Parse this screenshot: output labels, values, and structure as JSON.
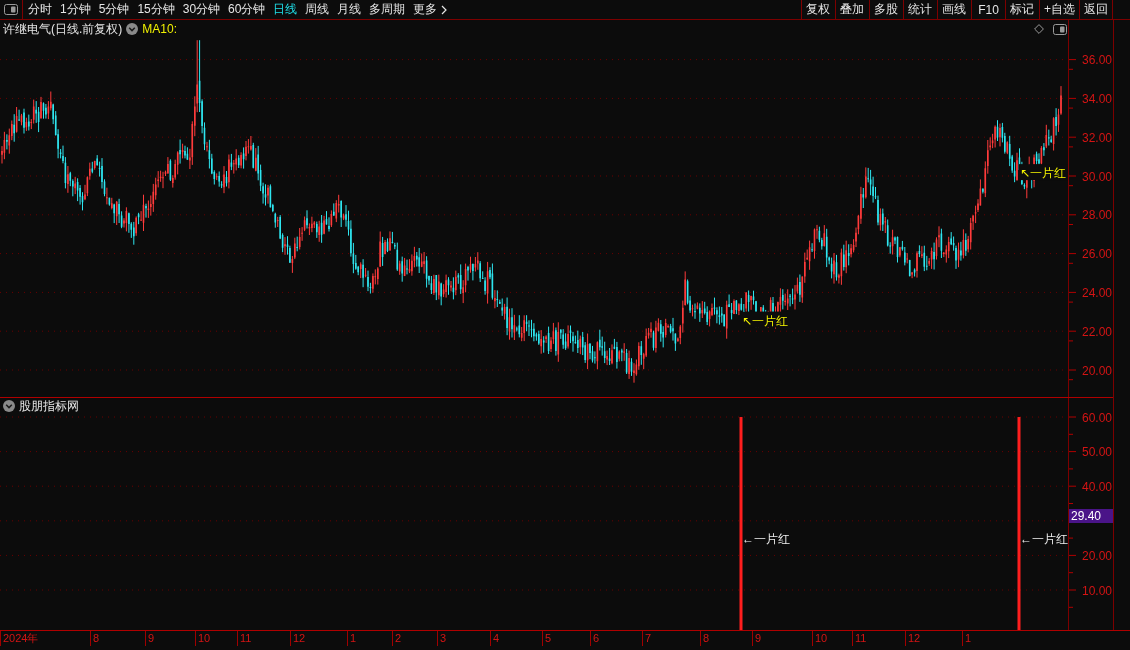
{
  "toolbar": {
    "periods": [
      {
        "label": "分时",
        "selected": false
      },
      {
        "label": "1分钟",
        "selected": false
      },
      {
        "label": "5分钟",
        "selected": false
      },
      {
        "label": "15分钟",
        "selected": false
      },
      {
        "label": "30分钟",
        "selected": false
      },
      {
        "label": "60分钟",
        "selected": false
      },
      {
        "label": "日线",
        "selected": true
      },
      {
        "label": "周线",
        "selected": false
      },
      {
        "label": "月线",
        "selected": false
      },
      {
        "label": "多周期",
        "selected": false
      }
    ],
    "more": "更多",
    "actions": [
      "复权",
      "叠加",
      "多股",
      "统计",
      "画线",
      "F10",
      "标记",
      "+自选",
      "返回"
    ]
  },
  "price_chart": {
    "title": "许继电气(日线.前复权)",
    "indicator": "MA10:",
    "price_axis": [
      "36.00",
      "34.00",
      "32.00",
      "30.00",
      "28.00",
      "26.00",
      "24.00",
      "22.00",
      "20.00"
    ],
    "annotations": [
      "↖一片红",
      "↖一片红"
    ]
  },
  "indicator_panel": {
    "title": "股朋指标网",
    "value_axis": [
      "60.00",
      "50.00",
      "40.00",
      "20.00",
      "10.00"
    ],
    "current_value": "29.40",
    "signals": [
      "←一片红",
      "←一片红"
    ]
  },
  "time_axis": [
    "2024年",
    "8",
    "9",
    "10",
    "11",
    "12",
    "1",
    "2",
    "3",
    "4",
    "5",
    "6",
    "7",
    "8",
    "9",
    "10",
    "11",
    "12",
    "1"
  ]
}
